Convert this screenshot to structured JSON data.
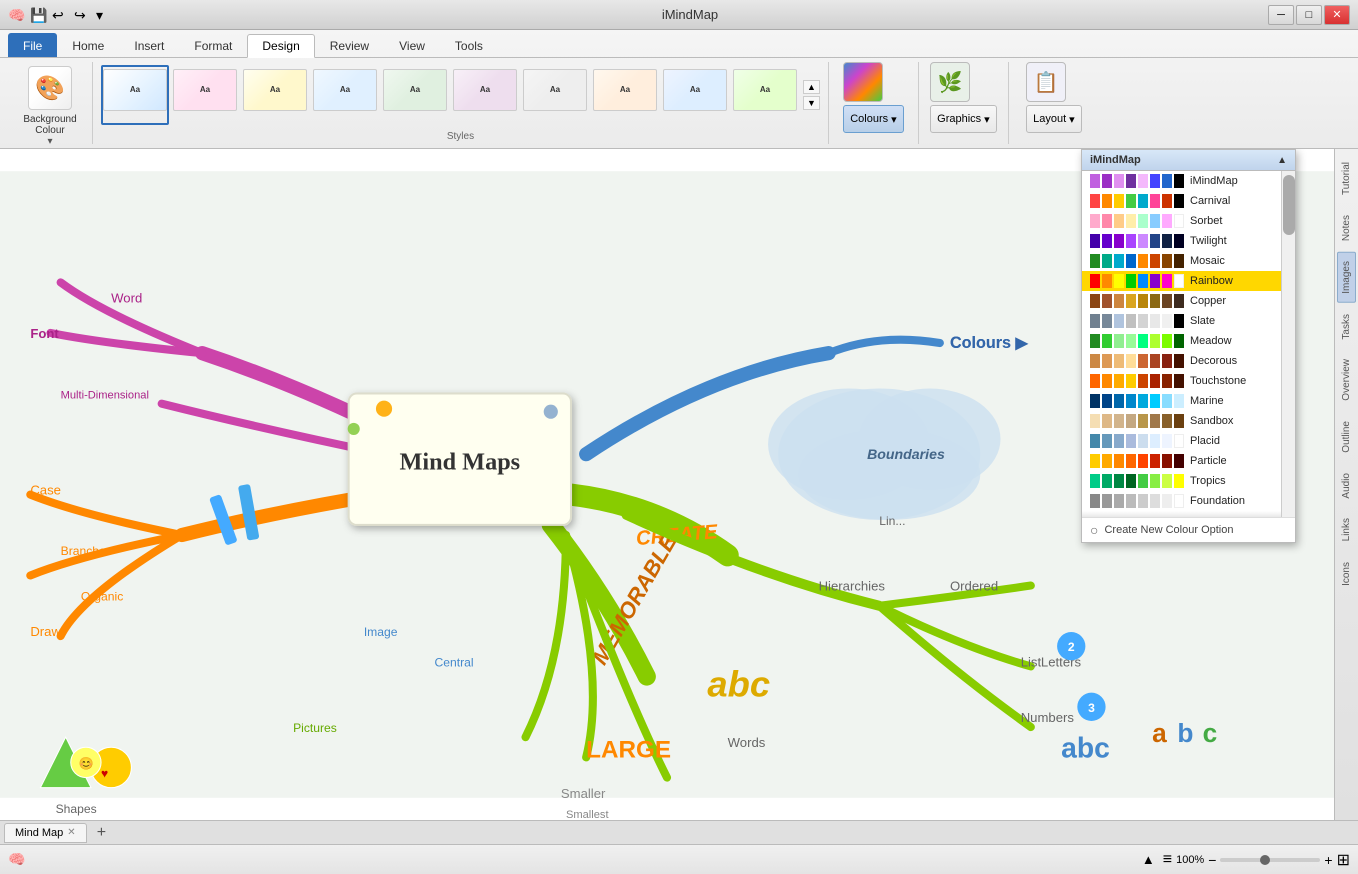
{
  "app": {
    "title": "iMindMap",
    "window_controls": [
      "minimize",
      "restore",
      "close"
    ]
  },
  "titlebar": {
    "icons": [
      "app-icon",
      "save-icon",
      "undo-icon",
      "redo-icon",
      "customize-icon"
    ],
    "title": "iMindMap"
  },
  "ribbon": {
    "tabs": [
      {
        "label": "File",
        "id": "file",
        "active": false
      },
      {
        "label": "Home",
        "id": "home",
        "active": false
      },
      {
        "label": "Insert",
        "id": "insert",
        "active": false
      },
      {
        "label": "Format",
        "id": "format",
        "active": false
      },
      {
        "label": "Design",
        "id": "design",
        "active": true
      },
      {
        "label": "Review",
        "id": "review",
        "active": false
      },
      {
        "label": "View",
        "id": "view",
        "active": false
      },
      {
        "label": "Tools",
        "id": "tools",
        "active": false
      }
    ],
    "groups": {
      "background": {
        "label": "Background",
        "bg_colour_label": "Background Colour"
      },
      "styles": {
        "label": "Styles",
        "items": [
          {
            "id": "s1",
            "selected": true
          },
          {
            "id": "s2"
          },
          {
            "id": "s3"
          },
          {
            "id": "s4"
          },
          {
            "id": "s5"
          },
          {
            "id": "s6"
          },
          {
            "id": "s7"
          },
          {
            "id": "s8"
          },
          {
            "id": "s9"
          },
          {
            "id": "s10"
          }
        ]
      },
      "colours": {
        "label": "Colours",
        "btn_label": "Colours",
        "active": true
      },
      "graphics": {
        "label": "Graphics",
        "btn_label": "Graphics"
      },
      "layout": {
        "label": "Layout",
        "btn_label": "Layout"
      }
    }
  },
  "colours_dropdown": {
    "title": "iMindMap",
    "scroll_up": "▲",
    "scroll_down": "▼",
    "items": [
      {
        "label": "iMindMap",
        "swatches": [
          "#c060e0",
          "#9b2fc5",
          "#e090f0",
          "#7030a0",
          "#f4b8fc",
          "#4444ff",
          "#2266cc",
          "#000000"
        ],
        "selected": false
      },
      {
        "label": "Carnival",
        "swatches": [
          "#ff4444",
          "#ff8800",
          "#ffcc00",
          "#44cc44",
          "#00aacc",
          "#ff4499",
          "#cc3300",
          "#000000"
        ],
        "selected": false
      },
      {
        "label": "Sorbet",
        "swatches": [
          "#ffaacc",
          "#ff88aa",
          "#ffcc88",
          "#ffeeaa",
          "#aaffcc",
          "#88ccff",
          "#ffaaff",
          "#ffffff"
        ],
        "selected": false
      },
      {
        "label": "Twilight",
        "swatches": [
          "#4400aa",
          "#6600cc",
          "#8800cc",
          "#aa44ff",
          "#cc88ff",
          "#224488",
          "#112244",
          "#000022"
        ],
        "selected": false
      },
      {
        "label": "Mosaic",
        "swatches": [
          "#228b22",
          "#00aa88",
          "#00aacc",
          "#0066cc",
          "#ff8800",
          "#cc4400",
          "#884400",
          "#442200"
        ],
        "selected": false
      },
      {
        "label": "Rainbow",
        "swatches": [
          "#ff0000",
          "#ff8800",
          "#ffff00",
          "#00cc00",
          "#0088ff",
          "#8800cc",
          "#ff00cc",
          "#ffffff"
        ],
        "selected": true
      },
      {
        "label": "Copper",
        "swatches": [
          "#8b4513",
          "#a0522d",
          "#cd853f",
          "#daa520",
          "#b8860b",
          "#8b6914",
          "#6b4423",
          "#3d2b1f"
        ],
        "selected": false
      },
      {
        "label": "Slate",
        "swatches": [
          "#708090",
          "#778899",
          "#b0c4de",
          "#c0c0c0",
          "#d3d3d3",
          "#e8e8e8",
          "#f0f0f0",
          "#000000"
        ],
        "selected": false
      },
      {
        "label": "Meadow",
        "swatches": [
          "#228b22",
          "#32cd32",
          "#90ee90",
          "#98fb98",
          "#00ff7f",
          "#adff2f",
          "#7cfc00",
          "#006400"
        ],
        "selected": false
      },
      {
        "label": "Decorous",
        "swatches": [
          "#cc8844",
          "#dd9955",
          "#eebb77",
          "#ffdd99",
          "#cc6633",
          "#aa4422",
          "#882211",
          "#441100"
        ],
        "selected": false
      },
      {
        "label": "Touchstone",
        "swatches": [
          "#ff6600",
          "#ff8800",
          "#ffaa00",
          "#ffcc00",
          "#cc4400",
          "#aa2200",
          "#882200",
          "#441100"
        ],
        "selected": false
      },
      {
        "label": "Marine",
        "swatches": [
          "#003366",
          "#004488",
          "#0066aa",
          "#0088cc",
          "#00aadd",
          "#00ccff",
          "#88ddff",
          "#cceeff"
        ],
        "selected": false
      },
      {
        "label": "Sandbox",
        "swatches": [
          "#f5deb3",
          "#deb887",
          "#d2b48c",
          "#c4a882",
          "#b8964a",
          "#a0784a",
          "#88602a",
          "#6b4010"
        ],
        "selected": false
      },
      {
        "label": "Placid",
        "swatches": [
          "#4488aa",
          "#6699bb",
          "#88aacc",
          "#aabbdd",
          "#ccddee",
          "#ddeeff",
          "#eef4ff",
          "#ffffff"
        ],
        "selected": false
      },
      {
        "label": "Particle",
        "swatches": [
          "#ffcc00",
          "#ffaa00",
          "#ff8800",
          "#ff6600",
          "#ff4400",
          "#cc2200",
          "#881100",
          "#440000"
        ],
        "selected": false
      },
      {
        "label": "Tropics",
        "swatches": [
          "#00cc88",
          "#00aa66",
          "#008844",
          "#006622",
          "#44cc44",
          "#88ee44",
          "#ccff44",
          "#ffff00"
        ],
        "selected": false
      },
      {
        "label": "Foundation",
        "swatches": [
          "#888888",
          "#999999",
          "#aaaaaa",
          "#bbbbbb",
          "#cccccc",
          "#dddddd",
          "#eeeeee",
          "#ffffff"
        ],
        "selected": false
      }
    ],
    "footer": {
      "icon": "+",
      "label": "Create New Colour Option"
    }
  },
  "right_panel": {
    "items": [
      {
        "label": "Tutorial",
        "active": false
      },
      {
        "label": "Notes",
        "active": false
      },
      {
        "label": "Images",
        "active": true
      },
      {
        "label": "Tasks",
        "active": false
      },
      {
        "label": "Overview",
        "active": false
      },
      {
        "label": "Outline",
        "active": false
      },
      {
        "label": "Audio",
        "active": false
      },
      {
        "label": "Links",
        "active": false
      },
      {
        "label": "Icons",
        "active": false
      }
    ]
  },
  "mindmap": {
    "central_topic": "Mind Maps",
    "branches": [
      "Font",
      "Word",
      "Case",
      "Branches",
      "Organic",
      "Draw",
      "Image",
      "Central",
      "Pictures",
      "LARGE",
      "Smaller",
      "Smallest",
      "Words",
      "Letters",
      "Ordered",
      "List",
      "Numbers",
      "Hierarchies",
      "Boundaries",
      "Colours",
      "CREATE",
      "MEMORABLE",
      "Multi-Dimensional",
      "Shapes",
      "Lines"
    ]
  },
  "tab_bar": {
    "tabs": [
      {
        "label": "Mind Map",
        "active": true
      }
    ],
    "add_btn": "+"
  },
  "bottom_bar": {
    "filter_icon": "≡",
    "zoom_level": "100%",
    "zoom_minus": "−",
    "zoom_plus": "+",
    "grid_icon": "⊞"
  }
}
